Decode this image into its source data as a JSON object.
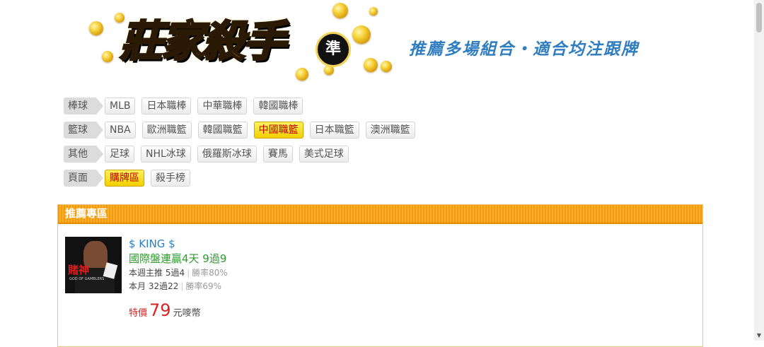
{
  "header": {
    "logo_text": "莊家殺手",
    "logo_badge": "準",
    "slogan": "推薦多場組合・適合均注跟牌"
  },
  "categories": [
    {
      "label": "棒球",
      "tags": [
        "MLB",
        "日本職棒",
        "中華職棒",
        "韓國職棒"
      ],
      "active": -1
    },
    {
      "label": "籃球",
      "tags": [
        "NBA",
        "歐洲職籃",
        "韓國職籃",
        "中國職籃",
        "日本職籃",
        "澳洲職籃"
      ],
      "active": 3
    },
    {
      "label": "其他",
      "tags": [
        "足球",
        "NHL冰球",
        "俄羅斯冰球",
        "賽馬",
        "美式足球"
      ],
      "active": -1
    },
    {
      "label": "頁面",
      "tags": [
        "購牌區",
        "殺手榜"
      ],
      "active": 0
    }
  ],
  "panel": {
    "title": "推薦專區",
    "card": {
      "name": "$ KING $",
      "headline": "國際盤連贏4天 9過9",
      "week_stat": "本週主推 5過4",
      "week_rate": "勝率80%",
      "month_stat": "本月 32過22",
      "month_rate": "勝率69%",
      "price_label": "特價",
      "price_value": "79",
      "price_unit": "元嘜幣",
      "thumb_text": "賭神",
      "thumb_sub": "GOD OF GAMBLERS"
    }
  },
  "colors": {
    "accent_orange": "#f39a0e",
    "active_yellow": "#f4cf00",
    "link_blue": "#2a7fc1",
    "headline_green": "#2f9a2f",
    "price_red": "#d22222"
  }
}
